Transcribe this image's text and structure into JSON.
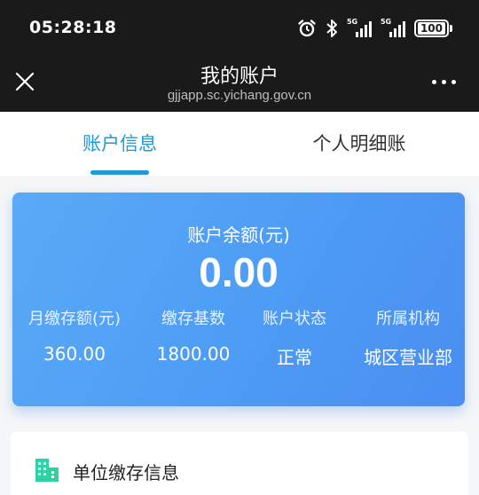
{
  "status_bar": {
    "time": "05:28:18",
    "sim1_tag": "5G",
    "sim2_tag": "5G",
    "battery": "100"
  },
  "nav": {
    "title": "我的账户",
    "url": "gjjapp.sc.yichang.gov.cn"
  },
  "tabs": [
    {
      "label": "账户信息",
      "active": true
    },
    {
      "label": "个人明细账",
      "active": false
    }
  ],
  "balance": {
    "label": "账户余额(元)",
    "value": "0.00",
    "stats": [
      {
        "label": "月缴存额(元)",
        "value": "360.00"
      },
      {
        "label": "缴存基数",
        "value": "1800.00"
      },
      {
        "label": "账户状态",
        "value": "正常"
      },
      {
        "label": "所属机构",
        "value": "城区营业部"
      }
    ]
  },
  "unit_section": {
    "title": "单位缴存信息"
  },
  "colors": {
    "accent": "#1e9ad6",
    "card_gradient_start": "#5aaaf7",
    "card_gradient_end": "#4a8ef1",
    "icon": "#2ed3a3"
  }
}
